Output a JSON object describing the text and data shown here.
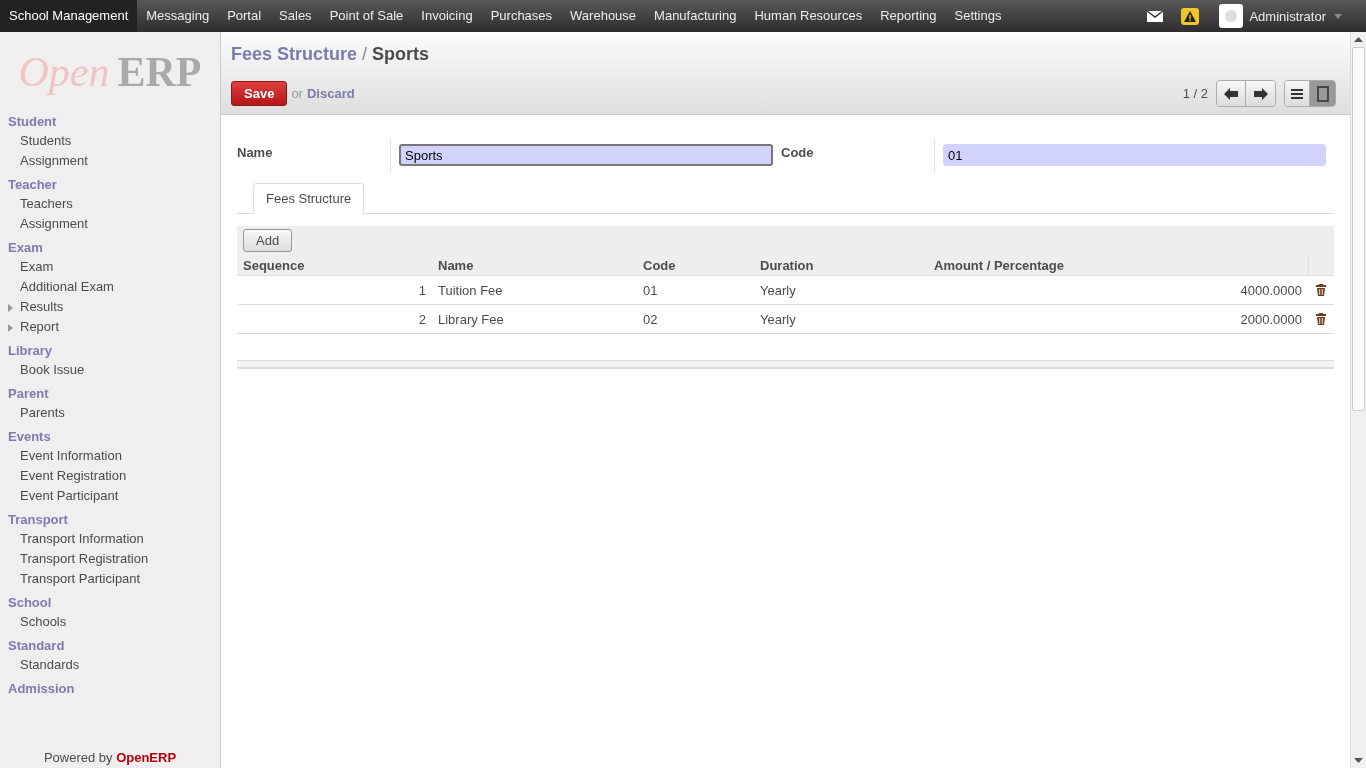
{
  "top_menu": [
    {
      "label": "School Management",
      "selected": true
    },
    {
      "label": "Messaging",
      "selected": false
    },
    {
      "label": "Portal",
      "selected": false
    },
    {
      "label": "Sales",
      "selected": false
    },
    {
      "label": "Point of Sale",
      "selected": false
    },
    {
      "label": "Invoicing",
      "selected": false
    },
    {
      "label": "Purchases",
      "selected": false
    },
    {
      "label": "Warehouse",
      "selected": false
    },
    {
      "label": "Manufacturing",
      "selected": false
    },
    {
      "label": "Human Resources",
      "selected": false
    },
    {
      "label": "Reporting",
      "selected": false
    },
    {
      "label": "Settings",
      "selected": false
    }
  ],
  "user": {
    "name": "Administrator"
  },
  "logo": {
    "part_1": "Open",
    "part_2": "ERP"
  },
  "sidebar": [
    {
      "title": "Student",
      "items": [
        {
          "label": "Students",
          "kind": "leaf"
        },
        {
          "label": "Assignment",
          "kind": "leaf"
        }
      ]
    },
    {
      "title": "Teacher",
      "items": [
        {
          "label": "Teachers",
          "kind": "leaf"
        },
        {
          "label": "Assignment",
          "kind": "leaf"
        }
      ]
    },
    {
      "title": "Exam",
      "items": [
        {
          "label": "Exam",
          "kind": "leaf"
        },
        {
          "label": "Additional Exam",
          "kind": "leaf"
        },
        {
          "label": "Results",
          "kind": "folder"
        },
        {
          "label": "Report",
          "kind": "folder"
        }
      ]
    },
    {
      "title": "Library",
      "items": [
        {
          "label": "Book Issue",
          "kind": "leaf"
        }
      ]
    },
    {
      "title": "Parent",
      "items": [
        {
          "label": "Parents",
          "kind": "leaf"
        }
      ]
    },
    {
      "title": "Events",
      "items": [
        {
          "label": "Event Information",
          "kind": "leaf"
        },
        {
          "label": "Event Registration",
          "kind": "leaf"
        },
        {
          "label": "Event Participant",
          "kind": "leaf"
        }
      ]
    },
    {
      "title": "Transport",
      "items": [
        {
          "label": "Transport Information",
          "kind": "leaf"
        },
        {
          "label": "Transport Registration",
          "kind": "leaf"
        },
        {
          "label": "Transport Participant",
          "kind": "leaf"
        }
      ]
    },
    {
      "title": "School",
      "items": [
        {
          "label": "Schools",
          "kind": "leaf"
        }
      ]
    },
    {
      "title": "Standard",
      "items": [
        {
          "label": "Standards",
          "kind": "leaf"
        }
      ]
    },
    {
      "title": "Admission"
    }
  ],
  "powered_by": {
    "text": "Powered by",
    "brand": "OpenERP"
  },
  "breadcrumb": {
    "parent": "Fees Structure",
    "separator": "/",
    "current": "Sports"
  },
  "actions": {
    "save": "Save",
    "or": "or",
    "discard": "Discard"
  },
  "pager": {
    "text": "1 / 2"
  },
  "views": [
    {
      "kind": "list",
      "selected": false
    },
    {
      "kind": "form",
      "selected": true
    }
  ],
  "fields": [
    {
      "label": "Name",
      "value": "Sports",
      "focused": true
    },
    {
      "label": "Code",
      "value": "01",
      "focused": false
    }
  ],
  "tabs": [
    {
      "label": "Fees Structure",
      "selected": true
    }
  ],
  "table": {
    "add": "Add",
    "columns": [
      "Sequence",
      "Name",
      "Code",
      "Duration",
      "Amount / Percentage"
    ],
    "rows": [
      [
        "1",
        "Tuition Fee",
        "01",
        "Yearly",
        "4000.0000"
      ],
      [
        "2",
        "Library Fee",
        "02",
        "Yearly",
        "2000.0000"
      ]
    ]
  }
}
